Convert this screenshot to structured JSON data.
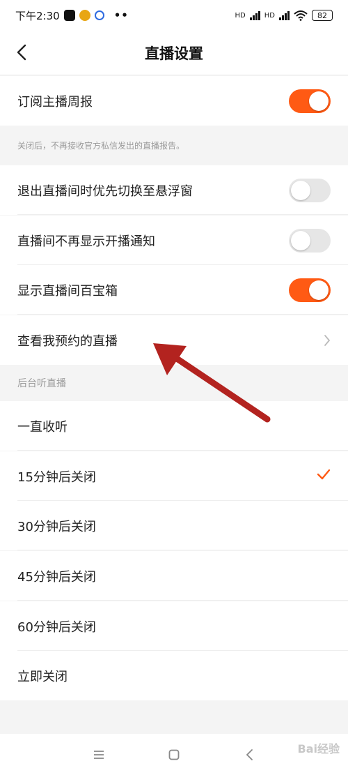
{
  "status_bar": {
    "time": "下午2:30",
    "net1": "HD",
    "net2": "HD",
    "battery": "82"
  },
  "header": {
    "title": "直播设置"
  },
  "settings": {
    "weekly_report": {
      "label": "订阅主播周报",
      "on": true
    },
    "weekly_report_note": "关闭后，不再接收官方私信发出的直播报告。",
    "float_window": {
      "label": "退出直播间时优先切换至悬浮窗",
      "on": false
    },
    "hide_notice": {
      "label": "直播间不再显示开播通知",
      "on": false
    },
    "treasure_box": {
      "label": "显示直播间百宝箱",
      "on": true
    },
    "my_reservations": {
      "label": "查看我预约的直播"
    }
  },
  "background_listen": {
    "title": "后台听直播",
    "options": [
      {
        "label": "一直收听",
        "selected": false
      },
      {
        "label": "15分钟后关闭",
        "selected": true
      },
      {
        "label": "30分钟后关闭",
        "selected": false
      },
      {
        "label": "45分钟后关闭",
        "selected": false
      },
      {
        "label": "60分钟后关闭",
        "selected": false
      },
      {
        "label": "立即关闭",
        "selected": false
      }
    ]
  },
  "watermark": "Bai经验",
  "colors": {
    "accent": "#ff5a14",
    "annotation_arrow": "#b3231f"
  },
  "icons": {
    "back": "chevron-left-icon",
    "chevron": "chevron-right-icon",
    "check": "check-icon",
    "menu": "menu-icon",
    "home": "home-square-icon",
    "nav_back": "back-triangle-icon"
  }
}
